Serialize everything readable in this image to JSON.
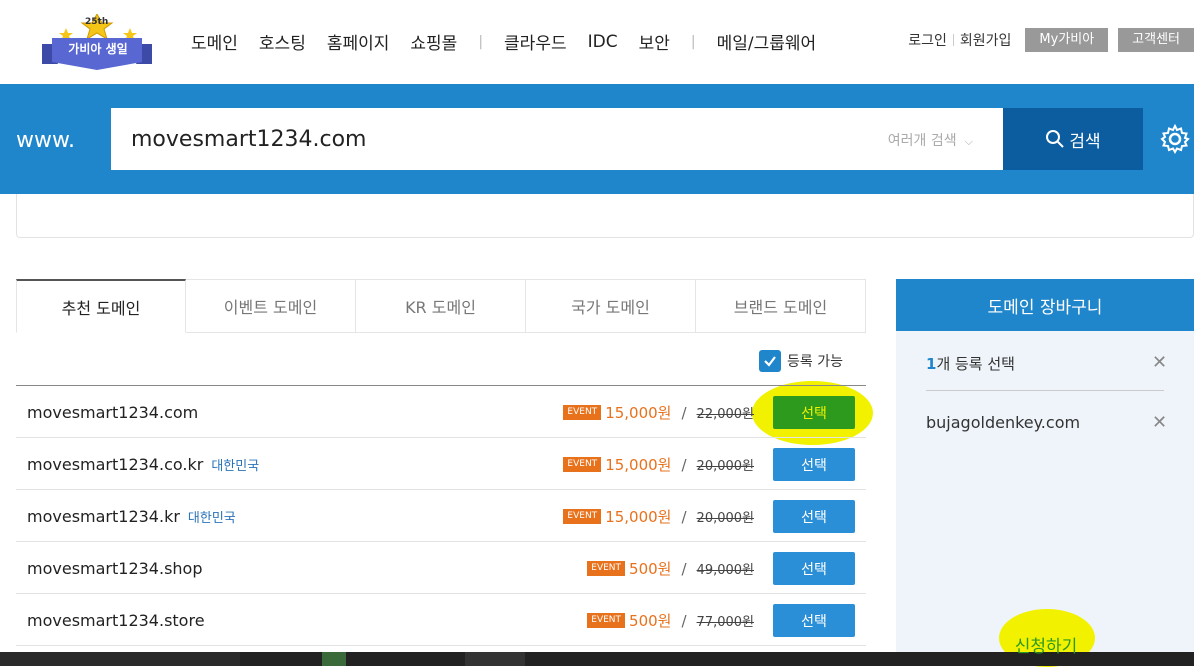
{
  "logo": {
    "badge": "25th",
    "text": "가비아 생일"
  },
  "gnb": [
    "도메인",
    "호스팅",
    "홈페이지",
    "쇼핑몰",
    "클라우드",
    "IDC",
    "보안",
    "메일/그룹웨어"
  ],
  "util": {
    "login": "로그인",
    "signup": "회원가입",
    "my": "My가비아",
    "support": "고객센터"
  },
  "search": {
    "prefix": "www.",
    "value": "movesmart1234.com",
    "multi": "여러개 검색",
    "button": "검색"
  },
  "tabs": [
    "추천 도메인",
    "이벤트 도메인",
    "KR 도메인",
    "국가 도메인",
    "브랜드 도메인"
  ],
  "filter": {
    "label": "등록 가능",
    "checked": true
  },
  "domains": [
    {
      "name": "movesmart1234.com",
      "country": "",
      "event": "EVENT",
      "sale": "15,000원",
      "orig": "22,000원",
      "btn": "선택"
    },
    {
      "name": "movesmart1234.co.kr",
      "country": "대한민국",
      "event": "EVENT",
      "sale": "15,000원",
      "orig": "20,000원",
      "btn": "선택"
    },
    {
      "name": "movesmart1234.kr",
      "country": "대한민국",
      "event": "EVENT",
      "sale": "15,000원",
      "orig": "20,000원",
      "btn": "선택"
    },
    {
      "name": "movesmart1234.shop",
      "country": "",
      "event": "EVENT",
      "sale": "500원",
      "orig": "49,000원",
      "btn": "선택"
    },
    {
      "name": "movesmart1234.store",
      "country": "",
      "event": "EVENT",
      "sale": "500원",
      "orig": "77,000원",
      "btn": "선택"
    }
  ],
  "cart": {
    "title": "도메인 장바구니",
    "count_num": "1",
    "count_text": "개 등록 선택",
    "item": "bujagoldenkey.com",
    "apply": "신청하기"
  },
  "colors": {
    "primary": "#1f86cc",
    "dark": "#0c5da0",
    "orange": "#e8711c",
    "highlight": "#f2f200",
    "green": "#2d9a1e"
  }
}
